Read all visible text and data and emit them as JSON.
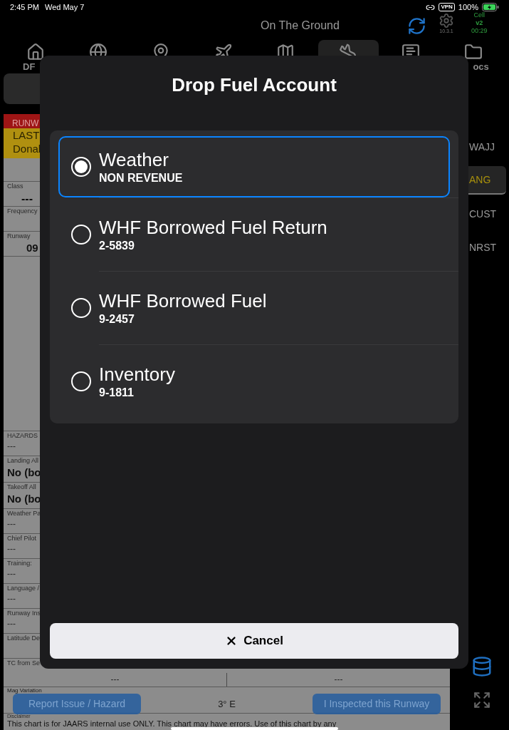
{
  "status_bar": {
    "time": "2:45 PM",
    "date": "Wed May 7",
    "vpn": "VPN",
    "battery": "100%"
  },
  "header": {
    "title": "On The Ground",
    "version": "10.3.1",
    "cell": [
      "Cell",
      "v2",
      "00:29"
    ]
  },
  "tabs": [
    {
      "kind": "home",
      "label": "DF",
      "selected": false
    },
    {
      "kind": "globe",
      "selected": false
    },
    {
      "kind": "pin",
      "selected": false
    },
    {
      "kind": "takeoff",
      "selected": false
    },
    {
      "kind": "map",
      "selected": false
    },
    {
      "kind": "landing",
      "selected": true
    },
    {
      "kind": "message",
      "selected": false
    },
    {
      "kind": "folder",
      "label": "ocs",
      "selected": false
    }
  ],
  "runway_banner": {
    "title": "RUNW",
    "lines": [
      "LAST",
      "Donal"
    ]
  },
  "fields_top": [
    {
      "label": "Class",
      "value": "---",
      "kind": "center"
    },
    {
      "label": "Frequency",
      "kind": "empty"
    },
    {
      "label": "Runway",
      "value": "09",
      "kind": "bold"
    }
  ],
  "fields_bottom": [
    {
      "label": "HAZARDS",
      "value": "---",
      "kind": "plain"
    },
    {
      "label": "Landing All",
      "value": "No (bo",
      "kind": "big"
    },
    {
      "label": "Takeoff All",
      "value": "No (bo",
      "kind": "big"
    },
    {
      "label": "Weather Pa",
      "value": "---",
      "kind": "plain"
    },
    {
      "label": "Chief Pilot",
      "value": "---",
      "kind": "plain"
    },
    {
      "label": "Training:",
      "value": "---",
      "kind": "plain"
    },
    {
      "label": "Language /",
      "value": "---",
      "kind": "plain"
    },
    {
      "label": "Runway Ins",
      "value": "---",
      "kind": "plain"
    },
    {
      "label": "Latitude De",
      "kind": "empty"
    }
  ],
  "tc_row": {
    "label": "TC from Se",
    "values": [
      "---",
      "---"
    ]
  },
  "mag_row": {
    "label": "Mag Variation",
    "value": "3° E",
    "buttons": [
      "Report Issue / Hazard",
      "I Inspected this Runway"
    ]
  },
  "disclaimer": {
    "label": "Disclaimer",
    "text": "This chart is for JAARS internal use ONLY. This chart may have errors. Use of this chart by any"
  },
  "sidebar": [
    {
      "label": "WAJJ",
      "selected": false
    },
    {
      "label": "ANG",
      "selected": true
    },
    {
      "label": "CUST",
      "selected": false
    },
    {
      "label": "NRST",
      "selected": false
    }
  ],
  "dialog": {
    "title": "Drop Fuel Account",
    "options": [
      {
        "title": "Weather",
        "subtitle": "NON REVENUE",
        "selected": true
      },
      {
        "title": "WHF Borrowed Fuel Return",
        "subtitle": "2-5839",
        "selected": false
      },
      {
        "title": "WHF Borrowed Fuel",
        "subtitle": "9-2457",
        "selected": false
      },
      {
        "title": "Inventory",
        "subtitle": "9-1811",
        "selected": false
      }
    ],
    "cancel": "Cancel"
  }
}
